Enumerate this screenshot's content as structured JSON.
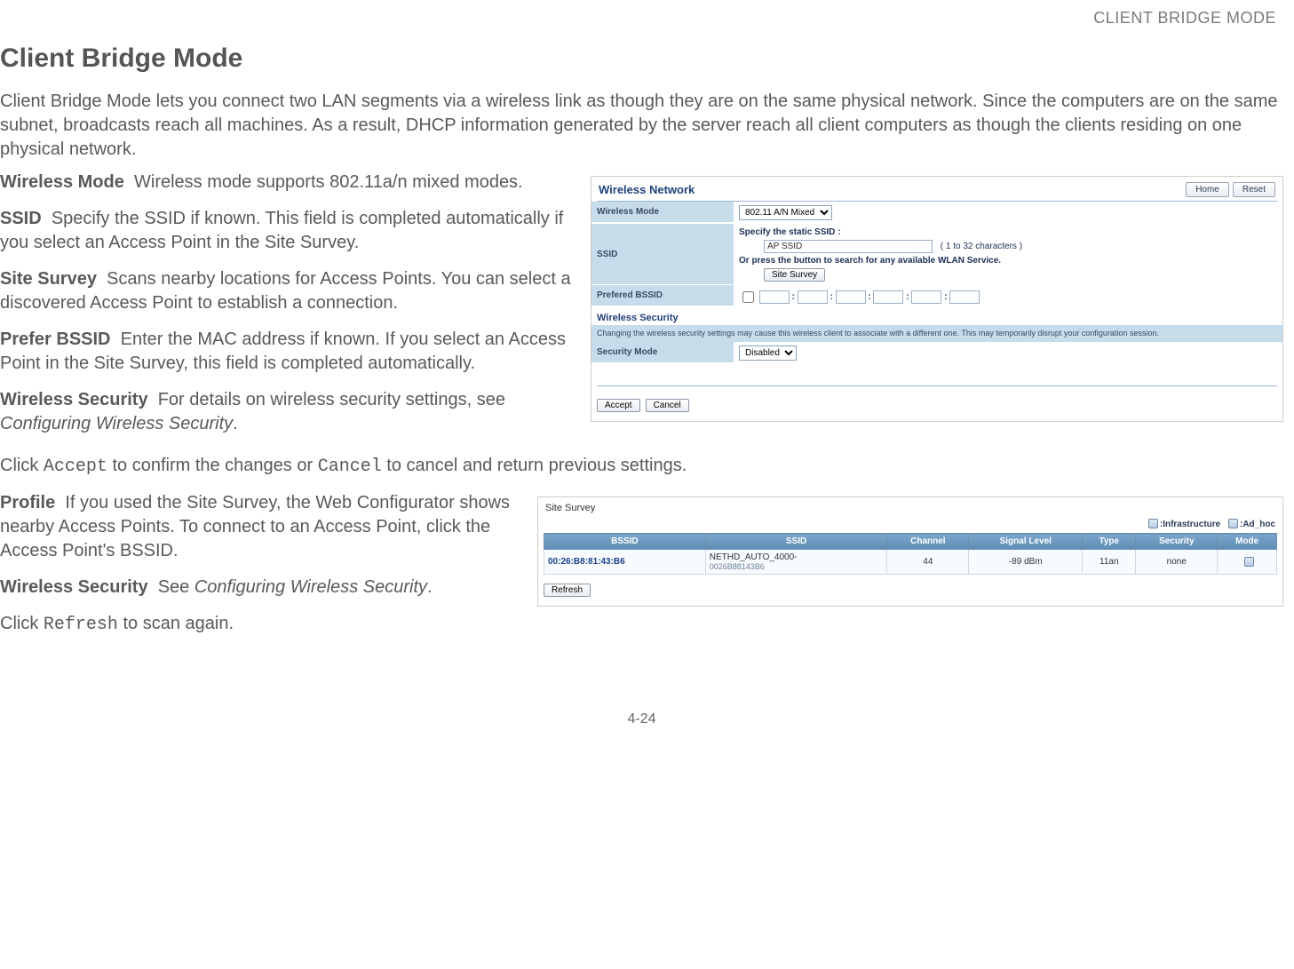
{
  "header_small": "CLIENT BRIDGE MODE",
  "page_title": "Client Bridge Mode",
  "intro": "Client Bridge Mode lets you connect two LAN segments via a wireless link as though they are on the same physical network. Since the computers are on the same subnet, broadcasts reach all machines. As a result, DHCP information generated by the server reach all client computers as though the clients residing on one physical network.",
  "defs1": {
    "wireless_mode_term": "Wireless Mode",
    "wireless_mode_text": "Wireless mode supports 802.11a/n mixed modes.",
    "ssid_term": "SSID",
    "ssid_text": "Specify the SSID if known. This field is completed automatically if you select an Access Point in the Site Survey.",
    "site_survey_term": "Site Survey",
    "site_survey_text": "Scans nearby locations for Access Points. You can select a discovered Access Point to establish a connection.",
    "prefer_bssid_term": "Prefer BSSID",
    "prefer_bssid_text": "Enter the MAC address if known. If you select an Access Point in the Site Survey, this field is completed automatically.",
    "wsec_term": "Wireless Security",
    "wsec_text_prefix": "For details on wireless security settings, see ",
    "wsec_link": "Configuring Wireless Security",
    "wsec_text_suffix": "."
  },
  "accept_line": {
    "prefix": "Click ",
    "accept": "Accept",
    "mid": " to confirm the changes or ",
    "cancel": "Cancel",
    "suffix": " to cancel and return previous settings."
  },
  "defs2": {
    "profile_term": "Profile",
    "profile_text": "If you used the Site Survey, the Web Configurator shows nearby Access Points. To connect to an Access Point, click the Access Point's BSSID.",
    "wsec2_term": "Wireless Security",
    "wsec2_text_prefix": "See ",
    "wsec2_link": "Configuring Wireless Security",
    "wsec2_text_suffix": "."
  },
  "refresh_line": {
    "prefix": "Click ",
    "refresh": "Refresh",
    "suffix": " to scan again."
  },
  "fig1": {
    "title": "Wireless Network",
    "btn_home": "Home",
    "btn_reset": "Reset",
    "row_mode_label": "Wireless Mode",
    "row_mode_value": "802.11 A/N Mixed",
    "row_ssid_label": "SSID",
    "ssid_specify": "Specify the static SSID  :",
    "ssid_input_value": "AP SSID",
    "ssid_chars": "( 1 to 32 characters )",
    "ssid_or": "Or press the button to search for any available WLAN Service.",
    "btn_site_survey": "Site Survey",
    "row_bssid_label": "Prefered BSSID",
    "subhead": "Wireless Security",
    "warn": "Changing the wireless security settings may cause this wireless client to associate with a different one. This may temporarily disrupt your configuration session.",
    "row_sec_label": "Security Mode",
    "row_sec_value": "Disabled",
    "btn_accept": "Accept",
    "btn_cancel": "Cancel"
  },
  "fig2": {
    "title": "Site Survey",
    "legend_infra": ":Infrastructure",
    "legend_adhoc": ":Ad_hoc",
    "cols": {
      "bssid": "BSSID",
      "ssid": "SSID",
      "channel": "Channel",
      "signal": "Signal Level",
      "type": "Type",
      "security": "Security",
      "mode": "Mode"
    },
    "row": {
      "bssid": "00:26:B8:81:43:B6",
      "ssid_main": "NETHD_AUTO_4000-",
      "ssid_sub": "0026B88143B6",
      "channel": "44",
      "signal": "-89 dBm",
      "type": "11an",
      "security": "none",
      "mode_icon": "i"
    },
    "btn_refresh": "Refresh"
  },
  "footer_page": "4-24"
}
